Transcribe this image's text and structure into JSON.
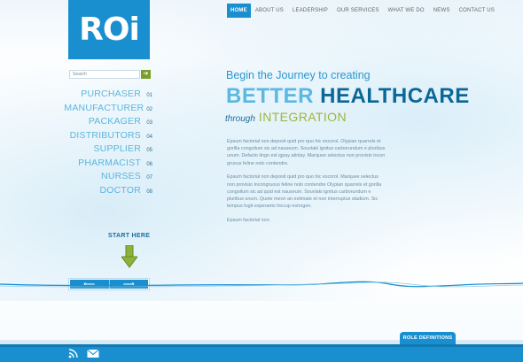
{
  "logo": {
    "text": "ROi"
  },
  "nav": {
    "items": [
      {
        "label": "HOME",
        "active": true
      },
      {
        "label": "ABOUT US",
        "active": false
      },
      {
        "label": "LEADERSHIP",
        "active": false
      },
      {
        "label": "OUR SERVICES",
        "active": false
      },
      {
        "label": "WHAT WE DO",
        "active": false
      },
      {
        "label": "NEWS",
        "active": false
      },
      {
        "label": "CONTACT US",
        "active": false
      }
    ]
  },
  "search": {
    "placeholder": "Search",
    "button_label": "➔"
  },
  "menu": {
    "items": [
      {
        "label": "PURCHASER",
        "num": "01"
      },
      {
        "label": "MANUFACTURER",
        "num": "02"
      },
      {
        "label": "PACKAGER",
        "num": "03"
      },
      {
        "label": "DISTRIBUTORS",
        "num": "04"
      },
      {
        "label": "SUPPLIER",
        "num": "05"
      },
      {
        "label": "PHARMACIST",
        "num": "06"
      },
      {
        "label": "NURSES",
        "num": "07"
      },
      {
        "label": "DOCTOR",
        "num": "08"
      }
    ]
  },
  "start_here": "START HERE",
  "pager": {
    "prev": "⟵",
    "next": "⟶"
  },
  "hero": {
    "line1": "Begin the Journey to creating",
    "line2_a": "BETTER ",
    "line2_b": "HEALTHCARE",
    "line3_a": "through",
    "line3_b": "INTEGRATION"
  },
  "body": {
    "p1": "Epsum factorial non deposit quid pro quo hic escorol. Olypian quarrels et gorilla congolium sic ad nauseum. Souvlaki ignitus carborundum e pluribus unum. Defacto lingo est igpay atinlay. Marquee selectus non provisio incon gruous feline nolo contendre.",
    "p2": "Epsum factorial non deposit quid pro quo hic escorol. Marquee selectus non provisio incongruous feline nolo contendre Olypian quarrels et gorilla congolium sic ad quid est nauseum. Souvlaki ignitus carborundum e pluribus unum. Quote meon an estimate et non interruptus stadium. Sic tempus fugit esperanto hiccup estrogen.",
    "p3": "Epsum factorial non."
  },
  "footer": {
    "tab_label": "ROLE DEFINITIONS",
    "icons": [
      "rss-icon",
      "mail-icon"
    ]
  },
  "colors": {
    "brand_blue": "#1a8fcf",
    "dark_blue": "#0c6799",
    "light_blue": "#5ab8e2",
    "accent_green": "#a0b43c"
  }
}
